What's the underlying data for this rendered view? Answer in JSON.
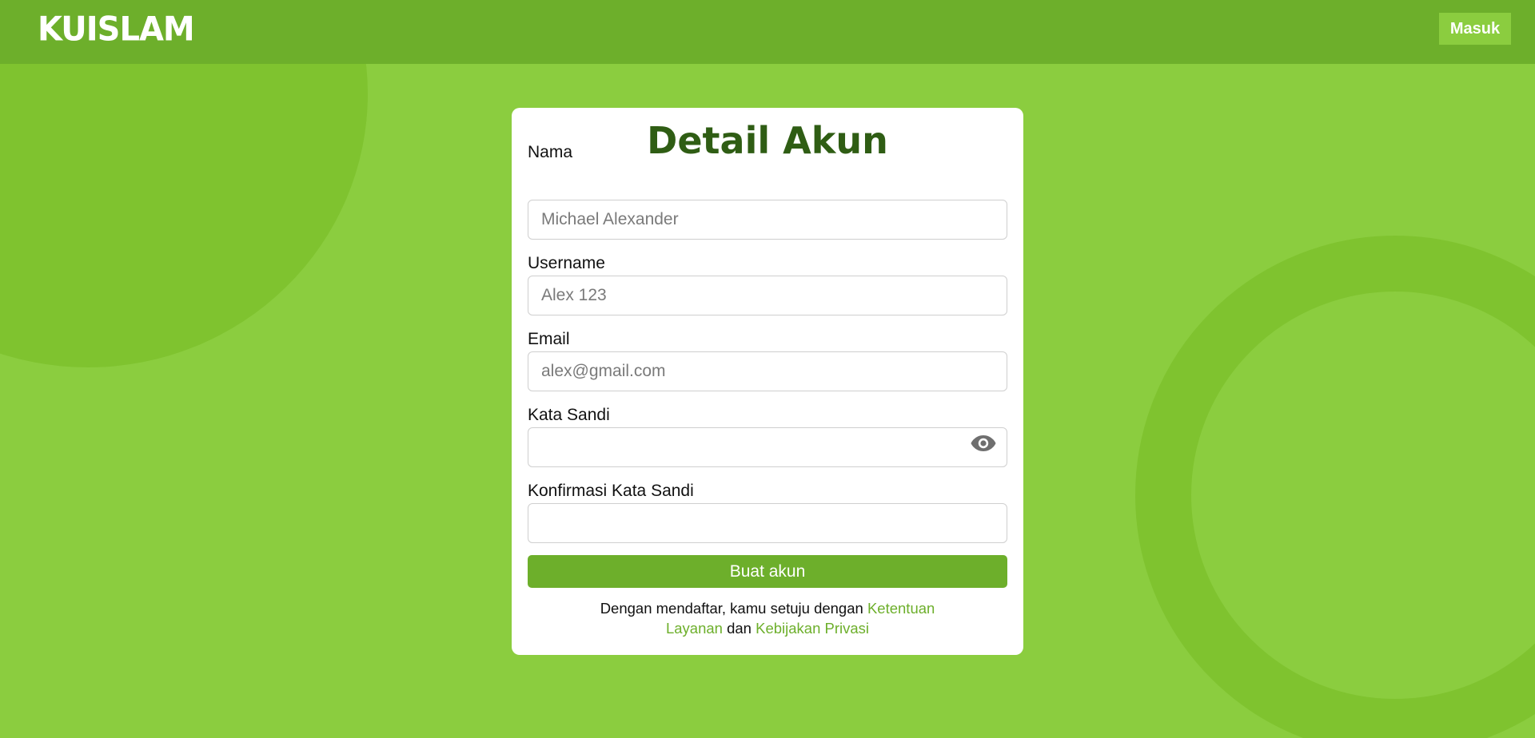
{
  "header": {
    "logo_text": "KUISLAM",
    "login_label": "Masuk"
  },
  "form": {
    "title": "Detail Akun",
    "fields": {
      "name": {
        "label": "Nama",
        "placeholder": "Michael Alexander",
        "value": ""
      },
      "username": {
        "label": "Username",
        "placeholder": "Alex 123",
        "value": ""
      },
      "email": {
        "label": "Email",
        "placeholder": "alex@gmail.com",
        "value": ""
      },
      "password": {
        "label": "Kata Sandi",
        "placeholder": "",
        "value": ""
      },
      "confirm_password": {
        "label": "Konfirmasi Kata Sandi",
        "placeholder": "",
        "value": ""
      }
    },
    "submit_label": "Buat akun",
    "terms": {
      "prefix": "Dengan mendaftar, kamu setuju dengan ",
      "terms_link": "Ketentuan Layanan",
      "conjunction": " dan ",
      "privacy_link": "Kebijakan Privasi"
    }
  },
  "icons": {
    "password_toggle": "eye-icon"
  },
  "colors": {
    "background": "#8bcd3f",
    "header": "#6daf2b",
    "accent": "#6daf2b",
    "title": "#2f5d14"
  }
}
